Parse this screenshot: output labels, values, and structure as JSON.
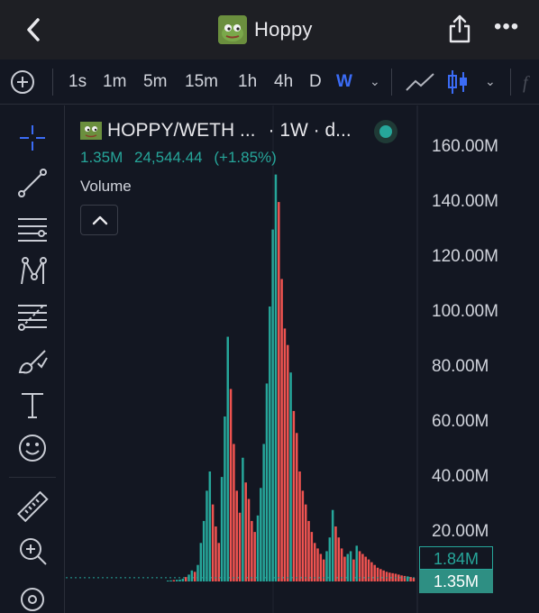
{
  "header": {
    "title": "Hoppy",
    "back_icon": "chevron-left-icon",
    "share_icon": "share-icon",
    "more_icon": "more-icon",
    "more_glyph": "•••"
  },
  "toolbar": {
    "intervals": [
      "1s",
      "1m",
      "5m",
      "15m",
      "1h",
      "4h",
      "D",
      "W"
    ],
    "active_interval": "W",
    "dropdown_glyph": "⌄"
  },
  "sidebar": {
    "tools": [
      "crosshair-icon",
      "trendline-icon",
      "horizontal-lines-icon",
      "pattern-icon",
      "fib-icon",
      "brush-icon",
      "text-icon",
      "emoji-icon",
      "ruler-icon",
      "zoom-in-icon",
      "magnet-icon"
    ]
  },
  "legend": {
    "pair": "HOPPY/WETH ...",
    "meta": "· 1W · d...",
    "volume_value": "1.35M",
    "price": "24,544.44",
    "change": "(+1.85%)",
    "volume_label": "Volume",
    "collapse_glyph": "^"
  },
  "axis": {
    "labels": [
      "160.00M",
      "140.00M",
      "120.00M",
      "100.00M",
      "80.00M",
      "60.00M",
      "40.00M",
      "20.00M"
    ],
    "badge_top": "1.84M",
    "badge_bottom": "1.35M"
  },
  "colors": {
    "up": "#26a69a",
    "down": "#ef5350",
    "accent": "#3b6cf6",
    "background": "#131722"
  },
  "chart_data": {
    "type": "bar",
    "series_name": "Volume",
    "y_unit": "M",
    "ylim": [
      0,
      165
    ],
    "current_value": 1.35,
    "badge_value": 1.84,
    "values": [
      0.3,
      0.4,
      0.5,
      0.6,
      0.7,
      1.0,
      1.6,
      2.5,
      4.0,
      3.5,
      6,
      14,
      22,
      33,
      40,
      28,
      20,
      14,
      38,
      60,
      89,
      70,
      50,
      33,
      25,
      45,
      36,
      30,
      22,
      18,
      24,
      34,
      50,
      72,
      100,
      128,
      148,
      138,
      110,
      92,
      86,
      76,
      62,
      54,
      40,
      33,
      28,
      22,
      18,
      14,
      12,
      10,
      8,
      11,
      16,
      26,
      20,
      16,
      12,
      9,
      10,
      11,
      8,
      13,
      11,
      10,
      9,
      8,
      7,
      6,
      5,
      4.5,
      4,
      3.5,
      3.2,
      3,
      2.8,
      2.5,
      2.2,
      2.0,
      1.84,
      1.6,
      1.35
    ],
    "directions": [
      "u",
      "u",
      "d",
      "u",
      "u",
      "u",
      "d",
      "u",
      "u",
      "d",
      "u",
      "u",
      "u",
      "u",
      "u",
      "d",
      "d",
      "d",
      "u",
      "u",
      "u",
      "d",
      "d",
      "d",
      "d",
      "u",
      "d",
      "d",
      "d",
      "d",
      "u",
      "u",
      "u",
      "u",
      "u",
      "u",
      "u",
      "d",
      "d",
      "d",
      "d",
      "u",
      "d",
      "d",
      "d",
      "d",
      "d",
      "d",
      "d",
      "d",
      "d",
      "d",
      "d",
      "u",
      "u",
      "u",
      "d",
      "d",
      "d",
      "d",
      "u",
      "u",
      "d",
      "u",
      "d",
      "d",
      "d",
      "d",
      "d",
      "d",
      "d",
      "d",
      "d",
      "d",
      "d",
      "d",
      "d",
      "d",
      "d",
      "d",
      "u",
      "d",
      "d"
    ]
  }
}
